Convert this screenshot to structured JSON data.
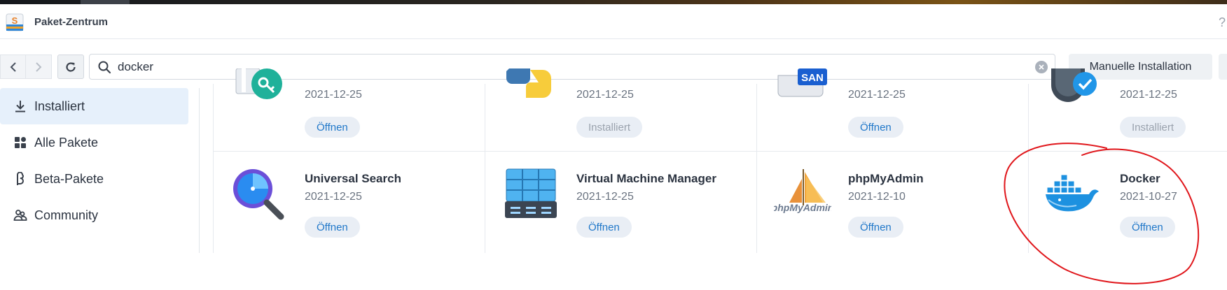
{
  "window": {
    "title": "Paket-Zentrum",
    "help_glyph": "?"
  },
  "toolbar": {
    "search_value": "docker",
    "manual_install_label": "Manuelle Installation"
  },
  "sidebar": {
    "items": [
      {
        "label": "Installiert",
        "icon": "download-icon",
        "active": true
      },
      {
        "label": "Alle Pakete",
        "icon": "grid-icon",
        "active": false
      },
      {
        "label": "Beta-Pakete",
        "icon": "beta-icon",
        "active": false
      },
      {
        "label": "Community",
        "icon": "community-icon",
        "active": false
      }
    ]
  },
  "packages_top": [
    {
      "date": "2021-12-25",
      "button": "Öffnen",
      "button_enabled": true,
      "icon": "key-manager-icon"
    },
    {
      "date": "2021-12-25",
      "button": "Installiert",
      "button_enabled": false,
      "icon": "python-icon"
    },
    {
      "date": "2021-12-25",
      "button": "Öffnen",
      "button_enabled": true,
      "icon": "san-manager-icon"
    },
    {
      "date": "2021-12-25",
      "button": "Installiert",
      "button_enabled": false,
      "icon": "security-icon"
    }
  ],
  "packages_bottom": [
    {
      "name": "Universal Search",
      "date": "2021-12-25",
      "button": "Öffnen",
      "button_enabled": true,
      "icon": "magnifier-icon"
    },
    {
      "name": "Virtual Machine Manager",
      "date": "2021-12-25",
      "button": "Öffnen",
      "button_enabled": true,
      "icon": "vm-manager-icon"
    },
    {
      "name": "phpMyAdmin",
      "date": "2021-12-10",
      "button": "Öffnen",
      "button_enabled": true,
      "icon": "phpmyadmin-icon",
      "logo_text": "phpMyAdmin"
    },
    {
      "name": "Docker",
      "date": "2021-10-27",
      "button": "Öffnen",
      "button_enabled": true,
      "icon": "docker-whale-icon"
    }
  ],
  "colors": {
    "accent": "#1f77c9",
    "active_sidebar": "#e6f0fb",
    "annotation_circle": "#e0161b"
  }
}
